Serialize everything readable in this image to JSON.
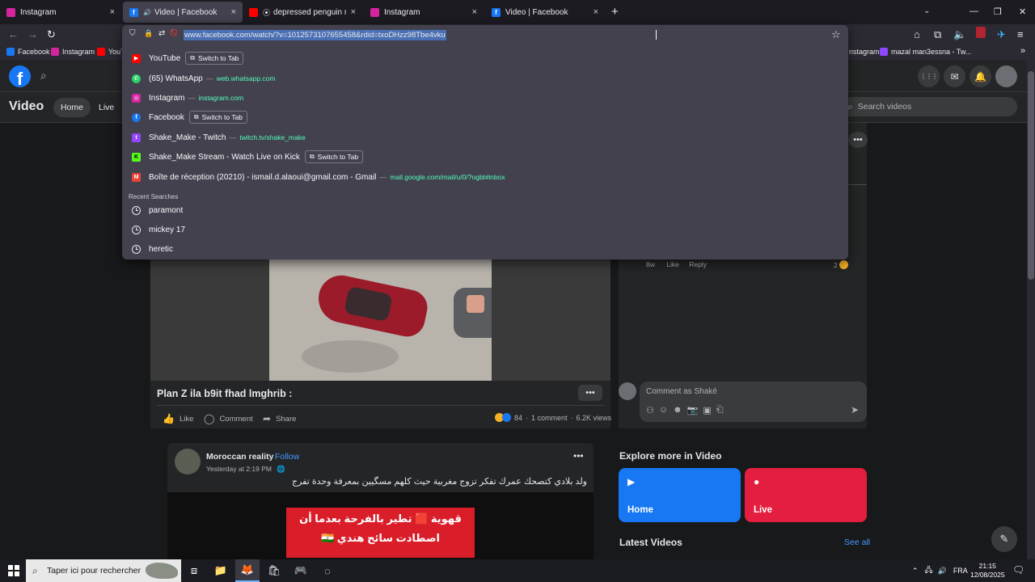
{
  "browser": {
    "tabs": [
      {
        "title": "Instagram",
        "color": "#d6249f",
        "glyph": "",
        "active": false
      },
      {
        "title": "Video | Facebook",
        "color": "#1877f2",
        "glyph": "f",
        "active": true,
        "sound": "🔊"
      },
      {
        "title": "depressed penguin meme -",
        "color": "#ff0000",
        "glyph": "",
        "active": false
      },
      {
        "title": "Instagram",
        "color": "#d6249f",
        "glyph": "",
        "active": false
      },
      {
        "title": "Video | Facebook",
        "color": "#1877f2",
        "glyph": "f",
        "active": false
      }
    ],
    "close_glyph": "×",
    "new_tab_glyph": "+",
    "tab_list_glyph": "⌄",
    "window_controls": {
      "minimize": "—",
      "restore": "❐",
      "close": "✕"
    },
    "nav": {
      "back": "←",
      "forward": "→",
      "reload": "↻",
      "home": "⌂",
      "extensions": "⧉",
      "mute": "🔈",
      "menu": "≡"
    },
    "url_icons": {
      "shield": "⛉",
      "lock": "🔒",
      "perm": "⇄",
      "bell": "🚫",
      "star": "☆"
    },
    "url": "www.facebook.com/watch/?v=1012573107655458&rdid=txoDHzz98Tbe4vku",
    "bookmarks": [
      {
        "label": "Facebook",
        "color": "#1877f2"
      },
      {
        "label": "Instagram",
        "color": "#d6249f"
      },
      {
        "label": "YouT",
        "color": "#ff0000"
      },
      {
        "label": "nstagram",
        "color": "#d6249f"
      },
      {
        "label": "mazal man3essna - Tw...",
        "color": "#9146ff"
      }
    ],
    "bookmarks_more": "»",
    "suggestions": [
      {
        "title": "YouTube",
        "url": "",
        "switch": "Switch to Tab",
        "color": "#ff0000",
        "glyph": "▶"
      },
      {
        "title": "(65) WhatsApp",
        "url": "web.whatsapp.com",
        "switch": "",
        "color": "#25d366",
        "glyph": "✆"
      },
      {
        "title": "Instagram",
        "url": "instagram.com",
        "switch": "",
        "color": "#d6249f",
        "glyph": "◎"
      },
      {
        "title": "Facebook",
        "url": "",
        "switch": "Switch to Tab",
        "color": "#1877f2",
        "glyph": "f"
      },
      {
        "title": "Shake_Make - Twitch",
        "url": "twitch.tv/shake_make",
        "switch": "",
        "color": "#9146ff",
        "glyph": "t"
      },
      {
        "title": "Shake_Make Stream - Watch Live on Kick",
        "url": "",
        "switch": "Switch to Tab",
        "color": "#53fc18",
        "glyph": "K"
      },
      {
        "title": "Boîte de réception (20210) - ismail.d.alaoui@gmail.com - Gmail",
        "url": "mail.google.com/mail/u/0/?ogbl#inbox",
        "switch": "",
        "color": "#ea4335",
        "glyph": "M"
      }
    ],
    "suggestion_dash": "—",
    "switch_glyph": "⧉",
    "recent_header": "Recent Searches",
    "recent": [
      "paramont",
      "mickey 17",
      "heretic"
    ]
  },
  "facebook": {
    "logo_glyph": "f",
    "search_glyph": "⌕",
    "top_icons": {
      "apps": "⋮⋮⋮",
      "messenger": "✉",
      "notifications": "🔔"
    },
    "section_title": "Video",
    "pills": [
      "Home",
      "Live"
    ],
    "search_placeholder": "Search videos",
    "dots": "•••",
    "post1": {
      "title": "Plan Z ila b9it fhad lmghrib :",
      "like": "Like",
      "comment": "Comment",
      "share": "Share",
      "reaction_count": "84",
      "comments": "1 comment",
      "views": "6.2K views",
      "like_glyph": "👍",
      "comment_glyph": "◯",
      "share_glyph": "➦",
      "sep": "·"
    },
    "right": {
      "comment_time": "8w",
      "comment_like": "Like",
      "comment_reply": "Reply",
      "comment_reactions": "2",
      "comment_placeholder": "Comment as Shaké",
      "comment_icons": [
        "⚇",
        "☺",
        "☻",
        "📷",
        "▣",
        "⎗"
      ],
      "send_glyph": "➤"
    },
    "post2": {
      "author": "Moroccan reality",
      "follow": "Follow",
      "time": "Yesterday at 2:19 PM",
      "globe": "·",
      "text": "ولد بلادي كتصحك عمرك تفكر تزوج مغربية حيث كلهم مسگيين بمعرفة وحدة تفرج",
      "thumb_line1": "قهوية 🟥 تطير بالفرحة بعدما أن",
      "thumb_line2": "اصطادت سائح هندي 🇮🇳"
    },
    "explore": {
      "title": "Explore more in Video",
      "cards": [
        {
          "label": "Home",
          "color": "#1877f2",
          "glyph": "▶"
        },
        {
          "label": "Live",
          "color": "#e41e3f",
          "glyph": "●"
        }
      ]
    },
    "latest": {
      "title": "Latest Videos",
      "see_all": "See all"
    },
    "edit_glyph": "✎"
  },
  "taskbar": {
    "search_placeholder": "Taper ici pour rechercher",
    "search_glyph": "⌕",
    "apps": [
      {
        "name": "task-view",
        "glyph": "⧈",
        "active": false
      },
      {
        "name": "file-explorer",
        "glyph": "📁",
        "active": false
      },
      {
        "name": "firefox",
        "glyph": "🦊",
        "active": true
      },
      {
        "name": "store",
        "glyph": "🛍",
        "active": false
      },
      {
        "name": "discord",
        "glyph": "🎮",
        "active": false
      },
      {
        "name": "app",
        "glyph": "◌",
        "active": false
      }
    ],
    "tray": {
      "chevron": "⌃",
      "network": "🖧",
      "volume": "🔊",
      "lang": "FRA",
      "notification": "🗨"
    },
    "time": "21:15",
    "date": "12/08/2025"
  },
  "colors": {
    "accent_link": "#4599ff",
    "url_text": "#54ffbd",
    "fb_blue": "#1877f2",
    "live_red": "#e41e3f"
  }
}
